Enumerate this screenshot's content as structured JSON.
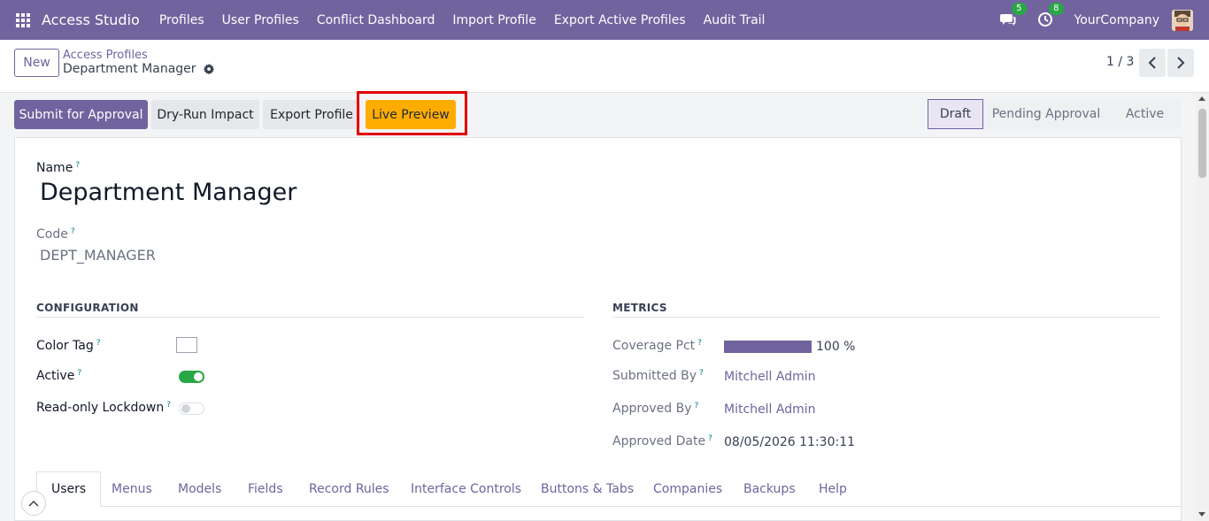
{
  "navbar": {
    "app_title": "Access Studio",
    "menu": [
      "Profiles",
      "User Profiles",
      "Conflict Dashboard",
      "Import Profile",
      "Export Active Profiles",
      "Audit Trail"
    ],
    "messages_badge": "5",
    "activity_badge": "8",
    "company": "YourCompany"
  },
  "control_panel": {
    "new_label": "New",
    "breadcrumb_parent": "Access Profiles",
    "breadcrumb_current": "Department Manager",
    "pager": "1 / 3"
  },
  "actions": {
    "submit": "Submit for Approval",
    "dry_run": "Dry-Run Impact",
    "export": "Export Profile",
    "live_preview": "Live Preview"
  },
  "statusbar": [
    "Draft",
    "Pending Approval",
    "Active"
  ],
  "form": {
    "name_label": "Name",
    "name_value": "Department Manager",
    "code_label": "Code",
    "code_value": "DEPT_MANAGER",
    "configuration_title": "CONFIGURATION",
    "metrics_title": "METRICS",
    "color_tag_label": "Color Tag",
    "active_label": "Active",
    "active_value": true,
    "readonly_label": "Read-only Lockdown",
    "readonly_value": false,
    "coverage_label": "Coverage Pct",
    "coverage_value": 100,
    "coverage_text": "100 %",
    "submitted_by_label": "Submitted By",
    "submitted_by_value": "Mitchell Admin",
    "approved_by_label": "Approved By",
    "approved_by_value": "Mitchell Admin",
    "approved_date_label": "Approved Date",
    "approved_date_value": "08/05/2026 11:30:11",
    "help_mark": "?"
  },
  "tabs": [
    "Users",
    "Menus",
    "Models",
    "Fields",
    "Record Rules",
    "Interface Controls",
    "Buttons & Tabs",
    "Companies",
    "Backups",
    "Help"
  ],
  "colors": {
    "brand": "#71639e",
    "live_preview_bg": "#ffac00",
    "toggle_on": "#28a745",
    "highlight_border": "#e00000"
  },
  "icons": {
    "apps": "apps-grid-icon",
    "messages": "chat-icon",
    "activity": "clock-icon",
    "settings": "gear-icon"
  }
}
